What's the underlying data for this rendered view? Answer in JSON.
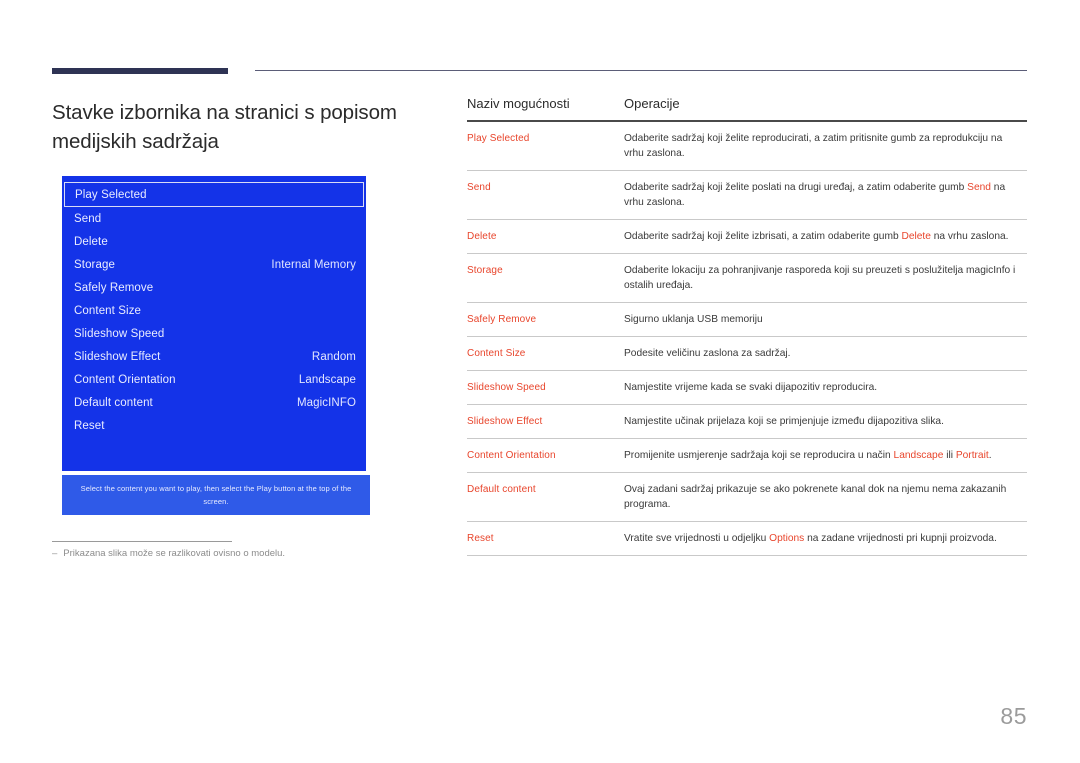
{
  "page": {
    "title": "Stavke izbornika na stranici s popisom medijskih sadržaja",
    "number": "85",
    "footnote_dash": "‒",
    "footnote_text": "Prikazana slika može se razlikovati ovisno o modelu.",
    "accent_color": "#2e3354",
    "highlight_color": "#e8452c",
    "osd_blue": "#1433e8"
  },
  "osd": {
    "items": [
      {
        "label": "Play Selected",
        "value": "",
        "selected": true
      },
      {
        "label": "Send",
        "value": "",
        "selected": false
      },
      {
        "label": "Delete",
        "value": "",
        "selected": false
      },
      {
        "label": "Storage",
        "value": "Internal Memory",
        "selected": false
      },
      {
        "label": "Safely Remove",
        "value": "",
        "selected": false
      },
      {
        "label": "Content Size",
        "value": "",
        "selected": false
      },
      {
        "label": "Slideshow Speed",
        "value": "",
        "selected": false
      },
      {
        "label": "Slideshow Effect",
        "value": "Random",
        "selected": false
      },
      {
        "label": "Content Orientation",
        "value": "Landscape",
        "selected": false
      },
      {
        "label": "Default content",
        "value": "MagicINFO",
        "selected": false
      },
      {
        "label": "Reset",
        "value": "",
        "selected": false
      }
    ],
    "hint": "Select the content you want to play, then select the Play button at the top of the screen."
  },
  "table": {
    "headers": {
      "name": "Naziv mogućnosti",
      "operation": "Operacije"
    },
    "rows": [
      {
        "name": "Play Selected",
        "desc_parts": [
          {
            "t": "Odaberite sadržaj koji želite reproducirati, a zatim pritisnite gumb za reprodukciju na vrhu zaslona.",
            "hl": false
          }
        ]
      },
      {
        "name": "Send",
        "desc_parts": [
          {
            "t": "Odaberite sadržaj koji želite poslati na drugi uređaj, a zatim odaberite gumb ",
            "hl": false
          },
          {
            "t": "Send",
            "hl": true
          },
          {
            "t": " na vrhu zaslona.",
            "hl": false
          }
        ]
      },
      {
        "name": "Delete",
        "desc_parts": [
          {
            "t": "Odaberite sadržaj koji želite izbrisati, a zatim odaberite gumb ",
            "hl": false
          },
          {
            "t": "Delete",
            "hl": true
          },
          {
            "t": " na vrhu zaslona.",
            "hl": false
          }
        ]
      },
      {
        "name": "Storage",
        "desc_parts": [
          {
            "t": "Odaberite lokaciju za pohranjivanje rasporeda koji su preuzeti s poslužitelja magicInfo i ostalih uređaja.",
            "hl": false
          }
        ]
      },
      {
        "name": "Safely Remove",
        "desc_parts": [
          {
            "t": "Sigurno uklanja USB memoriju",
            "hl": false
          }
        ]
      },
      {
        "name": "Content Size",
        "desc_parts": [
          {
            "t": "Podesite veličinu zaslona za sadržaj.",
            "hl": false
          }
        ]
      },
      {
        "name": "Slideshow Speed",
        "desc_parts": [
          {
            "t": "Namjestite vrijeme kada se svaki dijapozitiv reproducira.",
            "hl": false
          }
        ]
      },
      {
        "name": "Slideshow Effect",
        "desc_parts": [
          {
            "t": "Namjestite učinak prijelaza koji se primjenjuje između dijapozitiva slika.",
            "hl": false
          }
        ]
      },
      {
        "name": "Content Orientation",
        "desc_parts": [
          {
            "t": "Promijenite usmjerenje sadržaja koji se reproducira u način ",
            "hl": false
          },
          {
            "t": "Landscape",
            "hl": true
          },
          {
            "t": " ili ",
            "hl": false
          },
          {
            "t": "Portrait",
            "hl": true
          },
          {
            "t": ".",
            "hl": false
          }
        ]
      },
      {
        "name": "Default content",
        "desc_parts": [
          {
            "t": "Ovaj zadani sadržaj prikazuje se ako pokrenete kanal dok na njemu nema zakazanih programa.",
            "hl": false
          }
        ]
      },
      {
        "name": "Reset",
        "desc_parts": [
          {
            "t": "Vratite sve vrijednosti u odjeljku ",
            "hl": false
          },
          {
            "t": "Options",
            "hl": true
          },
          {
            "t": " na zadane vrijednosti pri kupnji proizvoda.",
            "hl": false
          }
        ]
      }
    ]
  }
}
